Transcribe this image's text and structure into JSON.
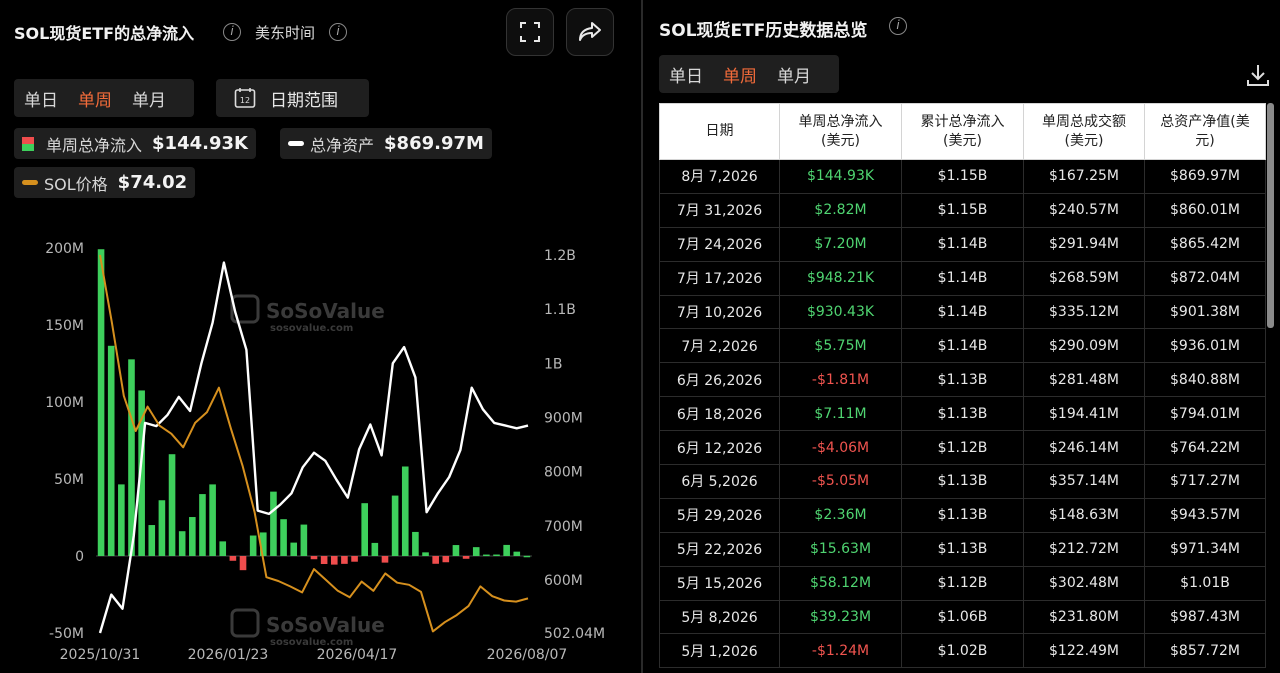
{
  "left_panel": {
    "title": "SOL现货ETF的总净流入",
    "timezone": "美东时间",
    "period_tabs": [
      "单日",
      "单周",
      "单月"
    ],
    "active_period": "单周",
    "date_range_label": "日期范围",
    "date_range_icon_text": "12",
    "legend": {
      "net_inflow_label": "单周总净流入",
      "net_inflow_value": "$144.93K",
      "net_assets_label": "总净资产",
      "net_assets_value": "$869.97M",
      "price_label": "SOL价格",
      "price_value": "$74.02"
    },
    "watermark": {
      "name": "SoSoValue",
      "url": "sosovalue.com"
    }
  },
  "colors": {
    "positive": "#3ecf5c",
    "negative": "#ef4d4d",
    "net_assets_line": "#ffffff",
    "price_line": "#d6901e",
    "accent": "#f26b3a"
  },
  "chart_data": {
    "type": "bar",
    "x_tick_labels": [
      "2025/10/31",
      "2026/01/23",
      "2026/04/17",
      "2026/08/07"
    ],
    "y_left": {
      "ticks": [
        "200M",
        "150M",
        "100M",
        "50M",
        "0",
        "-50M"
      ],
      "ylim": [
        -50,
        200
      ],
      "unit": "M USD"
    },
    "y_right": {
      "ticks": [
        "1.2B",
        "1.1B",
        "1B",
        "900M",
        "800M",
        "700M",
        "600M",
        "502.04M"
      ],
      "ylim": [
        502.04,
        1200
      ],
      "unit": "M USD"
    },
    "series": [
      {
        "name": "单周总净流入",
        "axis": "left",
        "type": "bar",
        "values": [
          199.2,
          136.5,
          46.5,
          127.7,
          107.5,
          20.1,
          36.2,
          66.1,
          16.1,
          25.3,
          40.2,
          46.5,
          9.5,
          -3.1,
          -9.2,
          13.3,
          15.3,
          41.8,
          23.9,
          8.7,
          20.4,
          -2.1,
          -5.2,
          -5.6,
          -5.1,
          -3.7,
          34.3,
          8.5,
          -4.3,
          39.23,
          58.12,
          15.63,
          2.36,
          -5.05,
          -4.06,
          7.11,
          -1.81,
          5.75,
          0.93,
          0.95,
          7.2,
          2.82,
          0.145
        ]
      },
      {
        "name": "总净资产",
        "axis": "right",
        "type": "line",
        "values": [
          502,
          573,
          547,
          682,
          890,
          884,
          905,
          938,
          912,
          1000,
          1075,
          1186,
          1095,
          1025,
          728,
          722,
          739,
          760,
          808,
          835,
          820,
          785,
          752,
          841,
          887,
          830,
          1000,
          1030,
          974,
          725,
          760,
          790,
          840,
          955,
          915,
          890,
          885,
          880,
          885
        ]
      },
      {
        "name": "SOL价格",
        "axis": "right",
        "type": "line",
        "values": [
          1200,
          1075,
          940,
          875,
          920,
          885,
          870,
          845,
          890,
          910,
          955,
          880,
          810,
          725,
          605,
          598,
          588,
          577,
          620,
          600,
          580,
          568,
          597,
          580,
          612,
          595,
          591,
          578,
          505,
          522,
          535,
          552,
          588,
          570,
          562,
          560,
          566
        ]
      }
    ]
  },
  "right_panel": {
    "title": "SOL现货ETF历史数据总览",
    "period_tabs": [
      "单日",
      "单周",
      "单月"
    ],
    "active_period": "单周",
    "download_icon": "download-icon",
    "table": {
      "headers": [
        [
          "日期"
        ],
        [
          "单周总净流入",
          "(美元)"
        ],
        [
          "累计总净流入",
          "(美元)"
        ],
        [
          "单周总成交额",
          "(美元)"
        ],
        [
          "总资产净值(美",
          "元)"
        ]
      ],
      "rows": [
        [
          "8月 7,2026",
          "$144.93K",
          "$1.15B",
          "$167.25M",
          "$869.97M"
        ],
        [
          "7月 31,2026",
          "$2.82M",
          "$1.15B",
          "$240.57M",
          "$860.01M"
        ],
        [
          "7月 24,2026",
          "$7.20M",
          "$1.14B",
          "$291.94M",
          "$865.42M"
        ],
        [
          "7月 17,2026",
          "$948.21K",
          "$1.14B",
          "$268.59M",
          "$872.04M"
        ],
        [
          "7月 10,2026",
          "$930.43K",
          "$1.14B",
          "$335.12M",
          "$901.38M"
        ],
        [
          "7月 2,2026",
          "$5.75M",
          "$1.14B",
          "$290.09M",
          "$936.01M"
        ],
        [
          "6月 26,2026",
          "-$1.81M",
          "$1.13B",
          "$281.48M",
          "$840.88M"
        ],
        [
          "6月 18,2026",
          "$7.11M",
          "$1.13B",
          "$194.41M",
          "$794.01M"
        ],
        [
          "6月 12,2026",
          "-$4.06M",
          "$1.12B",
          "$246.14M",
          "$764.22M"
        ],
        [
          "6月 5,2026",
          "-$5.05M",
          "$1.13B",
          "$357.14M",
          "$717.27M"
        ],
        [
          "5月 29,2026",
          "$2.36M",
          "$1.13B",
          "$148.63M",
          "$943.57M"
        ],
        [
          "5月 22,2026",
          "$15.63M",
          "$1.13B",
          "$212.72M",
          "$971.34M"
        ],
        [
          "5月 15,2026",
          "$58.12M",
          "$1.12B",
          "$302.48M",
          "$1.01B"
        ],
        [
          "5月 8,2026",
          "$39.23M",
          "$1.06B",
          "$231.80M",
          "$987.43M"
        ],
        [
          "5月 1,2026",
          "-$1.24M",
          "$1.02B",
          "$122.49M",
          "$857.72M"
        ]
      ]
    }
  }
}
